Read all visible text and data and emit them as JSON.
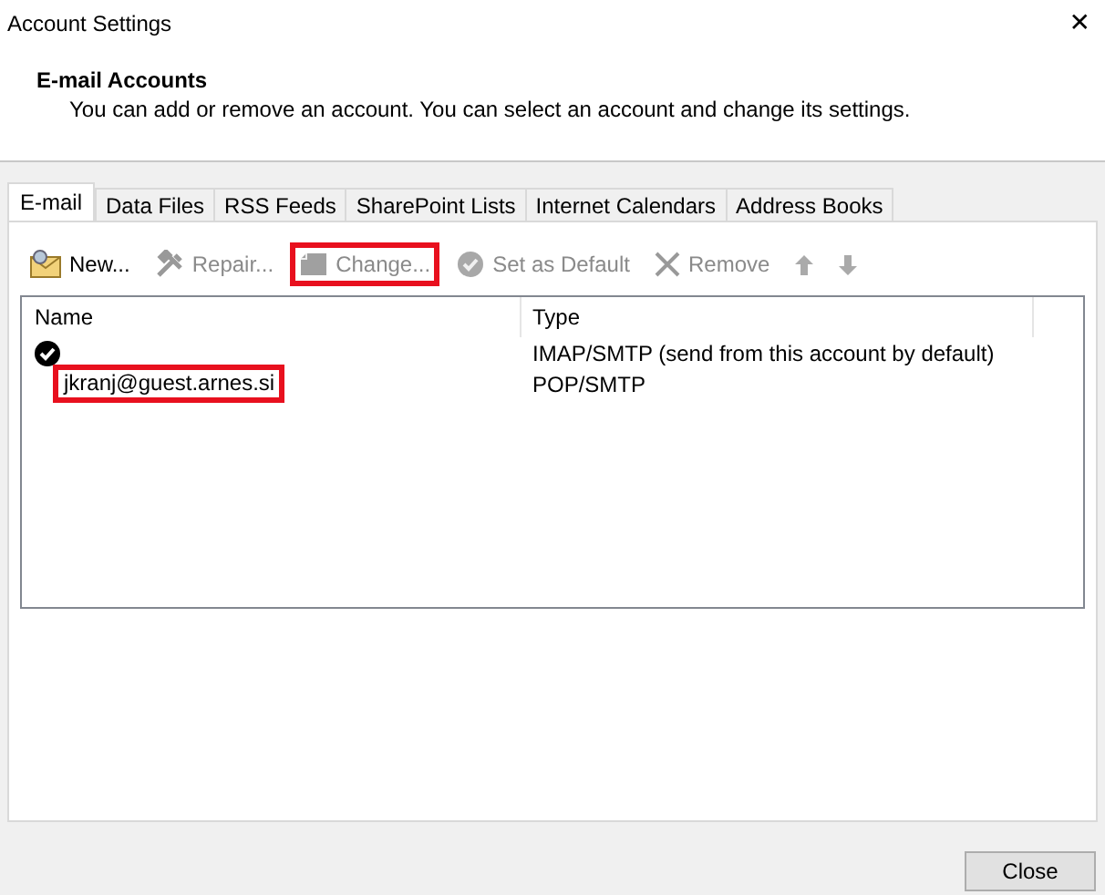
{
  "window": {
    "title": "Account Settings",
    "close_glyph": "✕"
  },
  "header": {
    "title": "E-mail Accounts",
    "description": "You can add or remove an account. You can select an account and change its settings."
  },
  "tabs": [
    {
      "label": "E-mail",
      "selected": true
    },
    {
      "label": "Data Files",
      "selected": false
    },
    {
      "label": "RSS Feeds",
      "selected": false
    },
    {
      "label": "SharePoint Lists",
      "selected": false
    },
    {
      "label": "Internet Calendars",
      "selected": false
    },
    {
      "label": "Address Books",
      "selected": false
    }
  ],
  "toolbar": [
    {
      "kind": "new",
      "label": "New...",
      "disabled": false,
      "highlighted": false
    },
    {
      "kind": "repair",
      "label": "Repair...",
      "disabled": true,
      "highlighted": false
    },
    {
      "kind": "change",
      "label": "Change...",
      "disabled": true,
      "highlighted": true
    },
    {
      "kind": "default",
      "label": "Set as Default",
      "disabled": true,
      "highlighted": false
    },
    {
      "kind": "remove",
      "label": "Remove",
      "disabled": true,
      "highlighted": false
    },
    {
      "kind": "up",
      "disabled": true,
      "highlighted": false
    },
    {
      "kind": "down",
      "disabled": true,
      "highlighted": false
    }
  ],
  "table": {
    "columns": [
      "Name",
      "Type"
    ],
    "rows": [
      {
        "is_default": true,
        "name_highlighted": false,
        "type": "IMAP/SMTP (send from this account by default)"
      },
      {
        "is_default": false,
        "name": "jkranj@guest.arnes.si",
        "name_highlighted": true,
        "type": "POP/SMTP"
      }
    ]
  },
  "buttons": [
    "Close"
  ]
}
